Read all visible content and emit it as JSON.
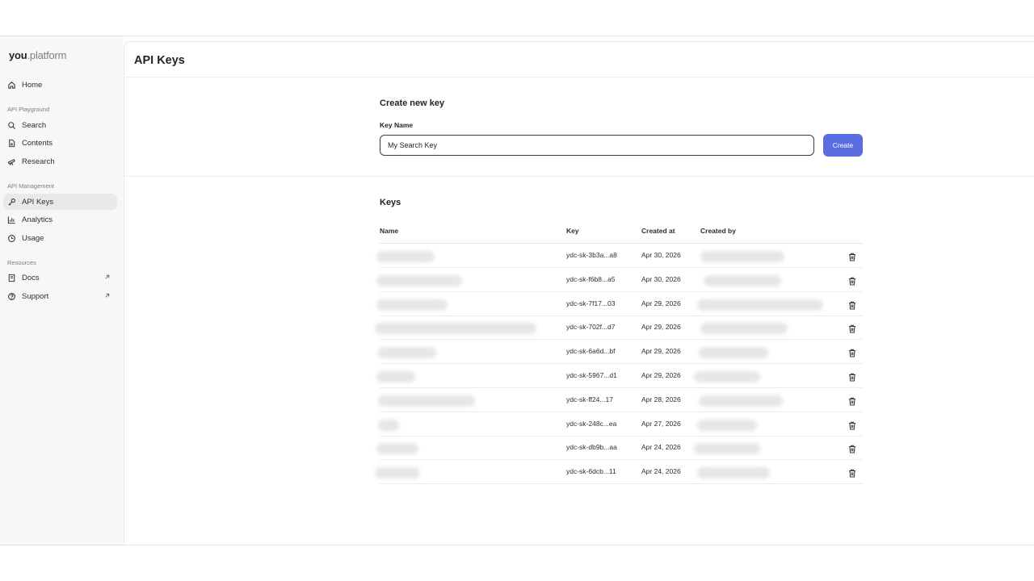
{
  "logo": {
    "bold": "you",
    "light": ".platform"
  },
  "sidebar": {
    "home": "Home",
    "section_playground": "API Playground",
    "search": "Search",
    "contents": "Contents",
    "research": "Research",
    "section_management": "API Management",
    "api_keys": "API Keys",
    "analytics": "Analytics",
    "usage": "Usage",
    "section_resources": "Resources",
    "docs": "Docs",
    "support": "Support"
  },
  "page": {
    "title": "API Keys"
  },
  "create": {
    "title": "Create new key",
    "label": "Key Name",
    "value": "My Search Key",
    "button": "Create"
  },
  "keys": {
    "title": "Keys",
    "headers": {
      "name": "Name",
      "key": "Key",
      "created_at": "Created at",
      "created_by": "Created by"
    },
    "rows": [
      {
        "key": "ydc-sk-3b3a...a8",
        "created_at": "Apr 30, 2026"
      },
      {
        "key": "ydc-sk-f6b8...a5",
        "created_at": "Apr 30, 2026"
      },
      {
        "key": "ydc-sk-7f17...03",
        "created_at": "Apr 29, 2026"
      },
      {
        "key": "ydc-sk-702f...d7",
        "created_at": "Apr 29, 2026"
      },
      {
        "key": "ydc-sk-6a6d...bf",
        "created_at": "Apr 29, 2026"
      },
      {
        "key": "ydc-sk-5967...d1",
        "created_at": "Apr 29, 2026"
      },
      {
        "key": "ydc-sk-ff24...17",
        "created_at": "Apr 28, 2026"
      },
      {
        "key": "ydc-sk-248c...ea",
        "created_at": "Apr 27, 2026"
      },
      {
        "key": "ydc-sk-db9b...aa",
        "created_at": "Apr 24, 2026"
      },
      {
        "key": "ydc-sk-6dcb...11",
        "created_at": "Apr 24, 2026"
      }
    ]
  },
  "colors": {
    "accent": "#5b6ee1",
    "sidebar_bg": "#f7f7f8",
    "active_bg": "#e9e9ec"
  },
  "icons": [
    "home-icon",
    "search-icon",
    "document-icon",
    "telescope-icon",
    "key-icon",
    "bar-chart-icon",
    "clock-icon",
    "book-icon",
    "help-circle-icon",
    "external-link-icon",
    "trash-icon"
  ]
}
